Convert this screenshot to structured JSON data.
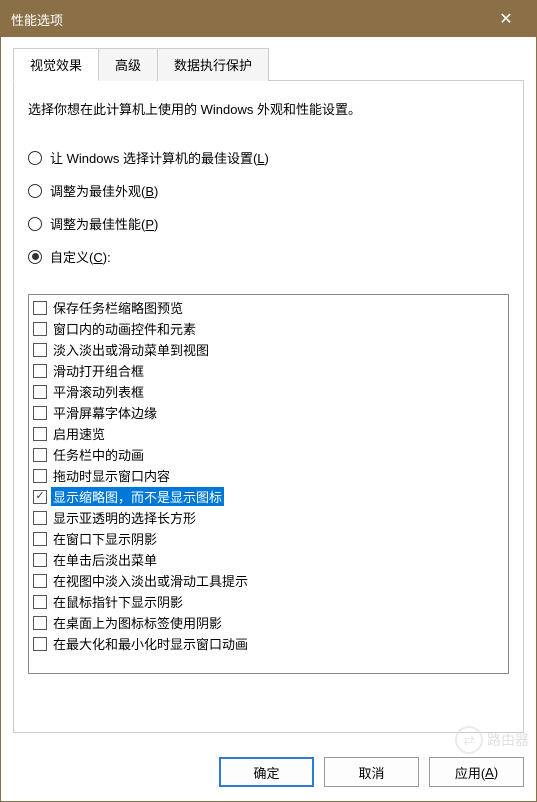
{
  "window": {
    "title": "性能选项"
  },
  "tabs": {
    "visual": "视觉效果",
    "advanced": "高级",
    "dep": "数据执行保护"
  },
  "description": "选择你想在此计算机上使用的 Windows 外观和性能设置。",
  "radios": {
    "auto_prefix": "让 Windows 选择计算机的最佳设置(",
    "auto_key": "L",
    "auto_suffix": ")",
    "best_look_prefix": "调整为最佳外观(",
    "best_look_key": "B",
    "best_look_suffix": ")",
    "best_perf_prefix": "调整为最佳性能(",
    "best_perf_key": "P",
    "best_perf_suffix": ")",
    "custom_prefix": "自定义(",
    "custom_key": "C",
    "custom_suffix": "):"
  },
  "options": [
    {
      "label": "保存任务栏缩略图预览",
      "checked": false,
      "selected": false
    },
    {
      "label": "窗口内的动画控件和元素",
      "checked": false,
      "selected": false
    },
    {
      "label": "淡入淡出或滑动菜单到视图",
      "checked": false,
      "selected": false
    },
    {
      "label": "滑动打开组合框",
      "checked": false,
      "selected": false
    },
    {
      "label": "平滑滚动列表框",
      "checked": false,
      "selected": false
    },
    {
      "label": "平滑屏幕字体边缘",
      "checked": false,
      "selected": false
    },
    {
      "label": "启用速览",
      "checked": false,
      "selected": false
    },
    {
      "label": "任务栏中的动画",
      "checked": false,
      "selected": false
    },
    {
      "label": "拖动时显示窗口内容",
      "checked": false,
      "selected": false
    },
    {
      "label": "显示缩略图，而不是显示图标",
      "checked": true,
      "selected": true
    },
    {
      "label": "显示亚透明的选择长方形",
      "checked": false,
      "selected": false
    },
    {
      "label": "在窗口下显示阴影",
      "checked": false,
      "selected": false
    },
    {
      "label": "在单击后淡出菜单",
      "checked": false,
      "selected": false
    },
    {
      "label": "在视图中淡入淡出或滑动工具提示",
      "checked": false,
      "selected": false
    },
    {
      "label": "在鼠标指针下显示阴影",
      "checked": false,
      "selected": false
    },
    {
      "label": "在桌面上为图标标签使用阴影",
      "checked": false,
      "selected": false
    },
    {
      "label": "在最大化和最小化时显示窗口动画",
      "checked": false,
      "selected": false
    }
  ],
  "buttons": {
    "ok": "确定",
    "cancel": "取消",
    "apply_prefix": "应用(",
    "apply_key": "A",
    "apply_suffix": ")"
  },
  "watermark": "路由器"
}
